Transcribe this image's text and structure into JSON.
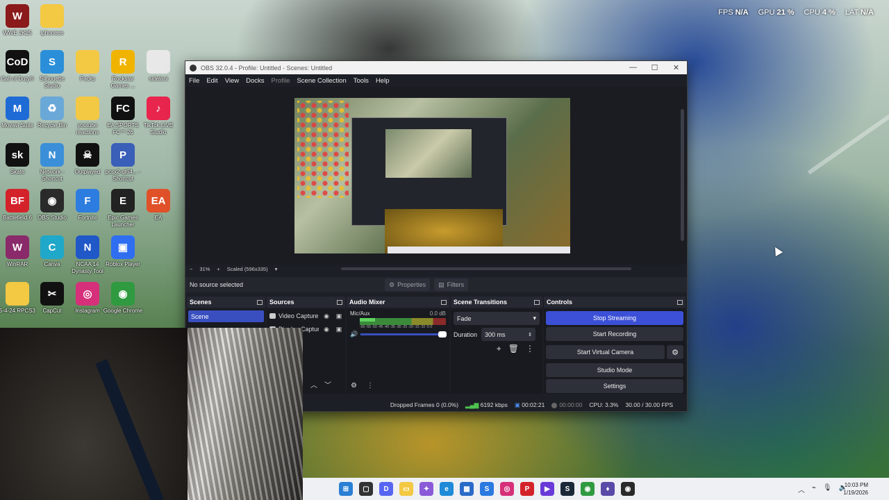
{
  "performance": {
    "fps_label": "FPS",
    "fps_value": "N/A",
    "gpu_label": "GPU",
    "gpu_value": "21 %",
    "cpu_label": "CPU",
    "cpu_value": "4 %",
    "lat_label": "LAT",
    "lat_value": "N/A"
  },
  "desktop": {
    "icons": [
      {
        "label": "WWE 2K25",
        "icon": "wwe-icon",
        "color": "#8b1a1a",
        "glyph": "W"
      },
      {
        "label": "iphoneee",
        "icon": "folder-icon",
        "color": "#f3c843",
        "glyph": ""
      },
      {
        "label": "Call of Duty®",
        "icon": "cod-icon",
        "color": "#111111",
        "glyph": "CoD"
      },
      {
        "label": "Silhouette Studio",
        "icon": "silhouette-icon",
        "color": "#2a8fd8",
        "glyph": "S"
      },
      {
        "label": "Packs",
        "icon": "folder-icon",
        "color": "#f3c843",
        "glyph": ""
      },
      {
        "label": "Rockstar Games ...",
        "icon": "rockstar-icon",
        "color": "#f0b400",
        "glyph": "R"
      },
      {
        "label": "sidelani",
        "icon": "file-icon",
        "color": "#e8e8e8",
        "glyph": ""
      },
      {
        "label": "Movavi Suite",
        "icon": "movavi-icon",
        "color": "#1e6bd6",
        "glyph": "M"
      },
      {
        "label": "Recycle Bin",
        "icon": "recycle-bin-icon",
        "color": "#6aa8d8",
        "glyph": "♻"
      },
      {
        "label": "youtube reactions",
        "icon": "folder-icon",
        "color": "#f3c843",
        "glyph": ""
      },
      {
        "label": "EA SPORTS FC™ 26",
        "icon": "easports-icon",
        "color": "#111111",
        "glyph": "FC"
      },
      {
        "label": "TikTok LIVE Studio",
        "icon": "tiktok-icon",
        "color": "#e8254d",
        "glyph": "♪"
      },
      {
        "label": "Skate",
        "icon": "skate-icon",
        "color": "#111111",
        "glyph": "sk"
      },
      {
        "label": "Network - Shortcut",
        "icon": "network-icon",
        "color": "#3a8fd8",
        "glyph": "N"
      },
      {
        "label": "Outplayed",
        "icon": "outplayed-icon",
        "color": "#111111",
        "glyph": "☠"
      },
      {
        "label": "pcsx2-qt64... - Shortcut",
        "icon": "pcsx2-icon",
        "color": "#3a5fb8",
        "glyph": "P"
      },
      {
        "label": "Battlefield 6",
        "icon": "battlefield-icon",
        "color": "#d4222a",
        "glyph": "BF"
      },
      {
        "label": "OBS Studio",
        "icon": "obs-icon",
        "color": "#2a2a2a",
        "glyph": "◉"
      },
      {
        "label": "Fortnite",
        "icon": "fortnite-icon",
        "color": "#2d7de0",
        "glyph": "F"
      },
      {
        "label": "Epic Games Launcher",
        "icon": "epic-icon",
        "color": "#222222",
        "glyph": "E"
      },
      {
        "label": "EA",
        "icon": "ea-icon",
        "color": "#e0512a",
        "glyph": "EA"
      },
      {
        "label": "WinRAR",
        "icon": "winrar-icon",
        "color": "#8a2a6a",
        "glyph": "W"
      },
      {
        "label": "Canva",
        "icon": "canva-icon",
        "color": "#1fa8c9",
        "glyph": "C"
      },
      {
        "label": "NCAA 14 Dynasty Tool",
        "icon": "ncaa-icon",
        "color": "#2058c8",
        "glyph": "N"
      },
      {
        "label": "Roblox Player",
        "icon": "roblox-icon",
        "color": "#2f6ef0",
        "glyph": "▣"
      },
      {
        "label": "5-4-24 RPCS3",
        "icon": "folder-icon",
        "color": "#f3c843",
        "glyph": ""
      },
      {
        "label": "CapCut",
        "icon": "capcut-icon",
        "color": "#111111",
        "glyph": "✂"
      },
      {
        "label": "Instagram",
        "icon": "instagram-icon",
        "color": "#d6307a",
        "glyph": "◎"
      },
      {
        "label": "Google Chrome",
        "icon": "chrome-icon",
        "color": "#2f9a3f",
        "glyph": "◉"
      }
    ]
  },
  "obs": {
    "title": "OBS 32.0.4 - Profile: Untitled - Scenes: Untitled",
    "menu": [
      "File",
      "Edit",
      "View",
      "Docks",
      "Profile",
      "Scene Collection",
      "Tools",
      "Help"
    ],
    "zoom": {
      "minus": "−",
      "value": "31%",
      "plus": "+",
      "scaled": "Scaled (596x335)"
    },
    "source_bar": {
      "no_source": "No source selected",
      "properties": "Properties",
      "filters": "Filters"
    },
    "scenes": {
      "title": "Scenes",
      "items": [
        "Scene"
      ]
    },
    "sources": {
      "title": "Sources",
      "items": [
        "Video Capture Device",
        "Display Capture"
      ]
    },
    "audio_mixer": {
      "title": "Audio Mixer",
      "channel": "Mic/Aux",
      "db": "0.0 dB",
      "ticks": "-60 -55 -50 -45 -40 -35 -30 -25 -20 -15 -10 -5 0",
      "level": 0.18
    },
    "transitions": {
      "title": "Scene Transitions",
      "selected": "Fade",
      "duration_label": "Duration",
      "duration_value": "300 ms"
    },
    "controls": {
      "title": "Controls",
      "stop_streaming": "Stop Streaming",
      "start_recording": "Start Recording",
      "start_virtual_camera": "Start Virtual Camera",
      "studio_mode": "Studio Mode",
      "settings": "Settings"
    },
    "status": {
      "dropped": "Dropped Frames 0 (0.0%)",
      "bitrate": "6192 kbps",
      "stream_time": "00:02:21",
      "rec_time": "00:00:00",
      "cpu": "CPU: 3.3%",
      "fps": "30.00 / 30.00 FPS"
    }
  },
  "taskbar": {
    "icons": [
      {
        "name": "start-icon",
        "color": "#2a7fd4",
        "glyph": "⊞"
      },
      {
        "name": "task-view-icon",
        "color": "#333333",
        "glyph": "▢"
      },
      {
        "name": "discord-icon",
        "color": "#5865f2",
        "glyph": "D"
      },
      {
        "name": "file-explorer-icon",
        "color": "#f3c843",
        "glyph": "▭"
      },
      {
        "name": "copilot-icon",
        "color": "#8a5ad8",
        "glyph": "✦"
      },
      {
        "name": "edge-icon",
        "color": "#1e8ad8",
        "glyph": "e"
      },
      {
        "name": "store-icon",
        "color": "#2a6ac8",
        "glyph": "▦"
      },
      {
        "name": "shazam-icon",
        "color": "#2a7ae0",
        "glyph": "S"
      },
      {
        "name": "instagram-icon",
        "color": "#d6307a",
        "glyph": "◎"
      },
      {
        "name": "pinterest-icon",
        "color": "#d4222a",
        "glyph": "P"
      },
      {
        "name": "video-editor-icon",
        "color": "#6a3ad8",
        "glyph": "▶"
      },
      {
        "name": "steam-icon",
        "color": "#1b2838",
        "glyph": "S"
      },
      {
        "name": "chrome-icon",
        "color": "#2f9a3f",
        "glyph": "◉"
      },
      {
        "name": "app-icon",
        "color": "#5a4aa8",
        "glyph": "♦"
      },
      {
        "name": "obs-icon",
        "color": "#2a2a2a",
        "glyph": "◉"
      }
    ],
    "time": "10:03 PM",
    "date": "1/19/2026"
  }
}
